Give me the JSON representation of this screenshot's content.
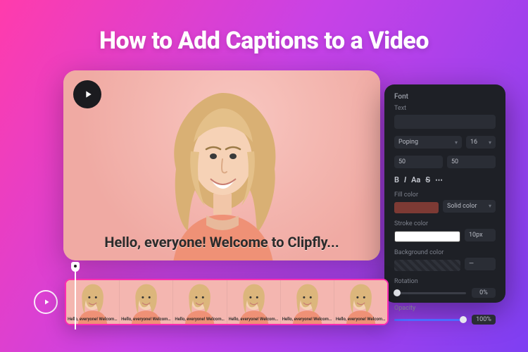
{
  "title": "How to Add Captions to a Video",
  "preview": {
    "caption_text": "Hello, everyone! Welcome to Clipfly..."
  },
  "panel": {
    "section_font": "Font",
    "text_label": "Text",
    "font_family": "Poping",
    "font_size": "16",
    "value_a": "50",
    "value_b": "50",
    "tools": {
      "bold": "B",
      "italic": "I",
      "case": "Aa",
      "strike": "S",
      "more": "⋯"
    },
    "fill_color_label": "Fill color",
    "fill_mode": "Solid color",
    "stroke_color_label": "Stroke color",
    "stroke_width": "10px",
    "background_color_label": "Background color",
    "bg_mode": "—",
    "rotation_label": "Rotation",
    "rotation_value": "0%",
    "opacity_label": "Opacity",
    "opacity_value": "100%"
  },
  "timeline": {
    "thumb_caption": "Hello, everyone! Welcome to Clipfly...",
    "thumb_count": 6
  }
}
